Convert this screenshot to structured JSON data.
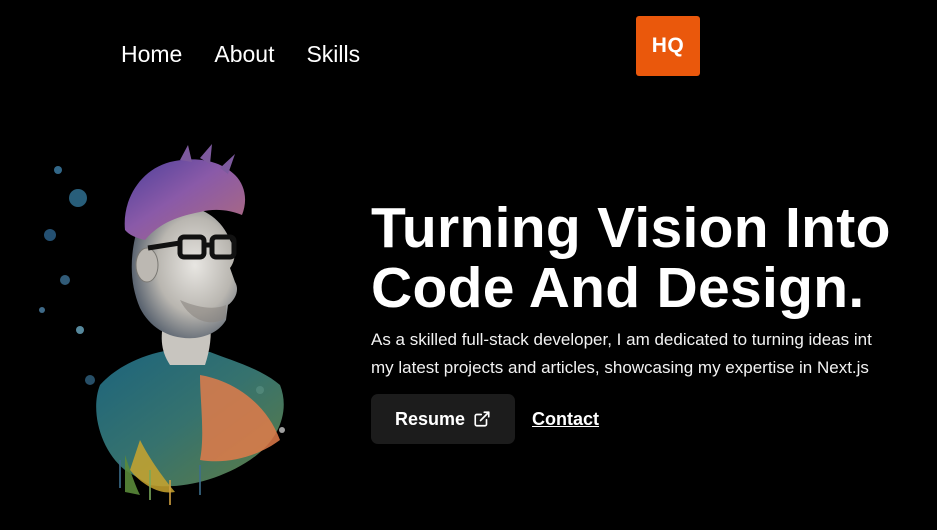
{
  "nav": {
    "items": [
      {
        "label": "Home"
      },
      {
        "label": "About"
      },
      {
        "label": "Skills"
      }
    ]
  },
  "logo": {
    "text": "HQ",
    "color": "#ea580c"
  },
  "hero": {
    "headline_line1": "Turning Vision Into",
    "headline_line2": "Code And Design.",
    "intro_line1": "As a skilled full-stack developer, I am dedicated to turning ideas int",
    "intro_line2": "my latest projects and articles, showcasing my expertise in Next.js",
    "resume_label": "Resume",
    "resume_icon": "external-link-icon",
    "contact_label": "Contact"
  },
  "portrait": {
    "icon": "watercolor-portrait-illustration"
  }
}
